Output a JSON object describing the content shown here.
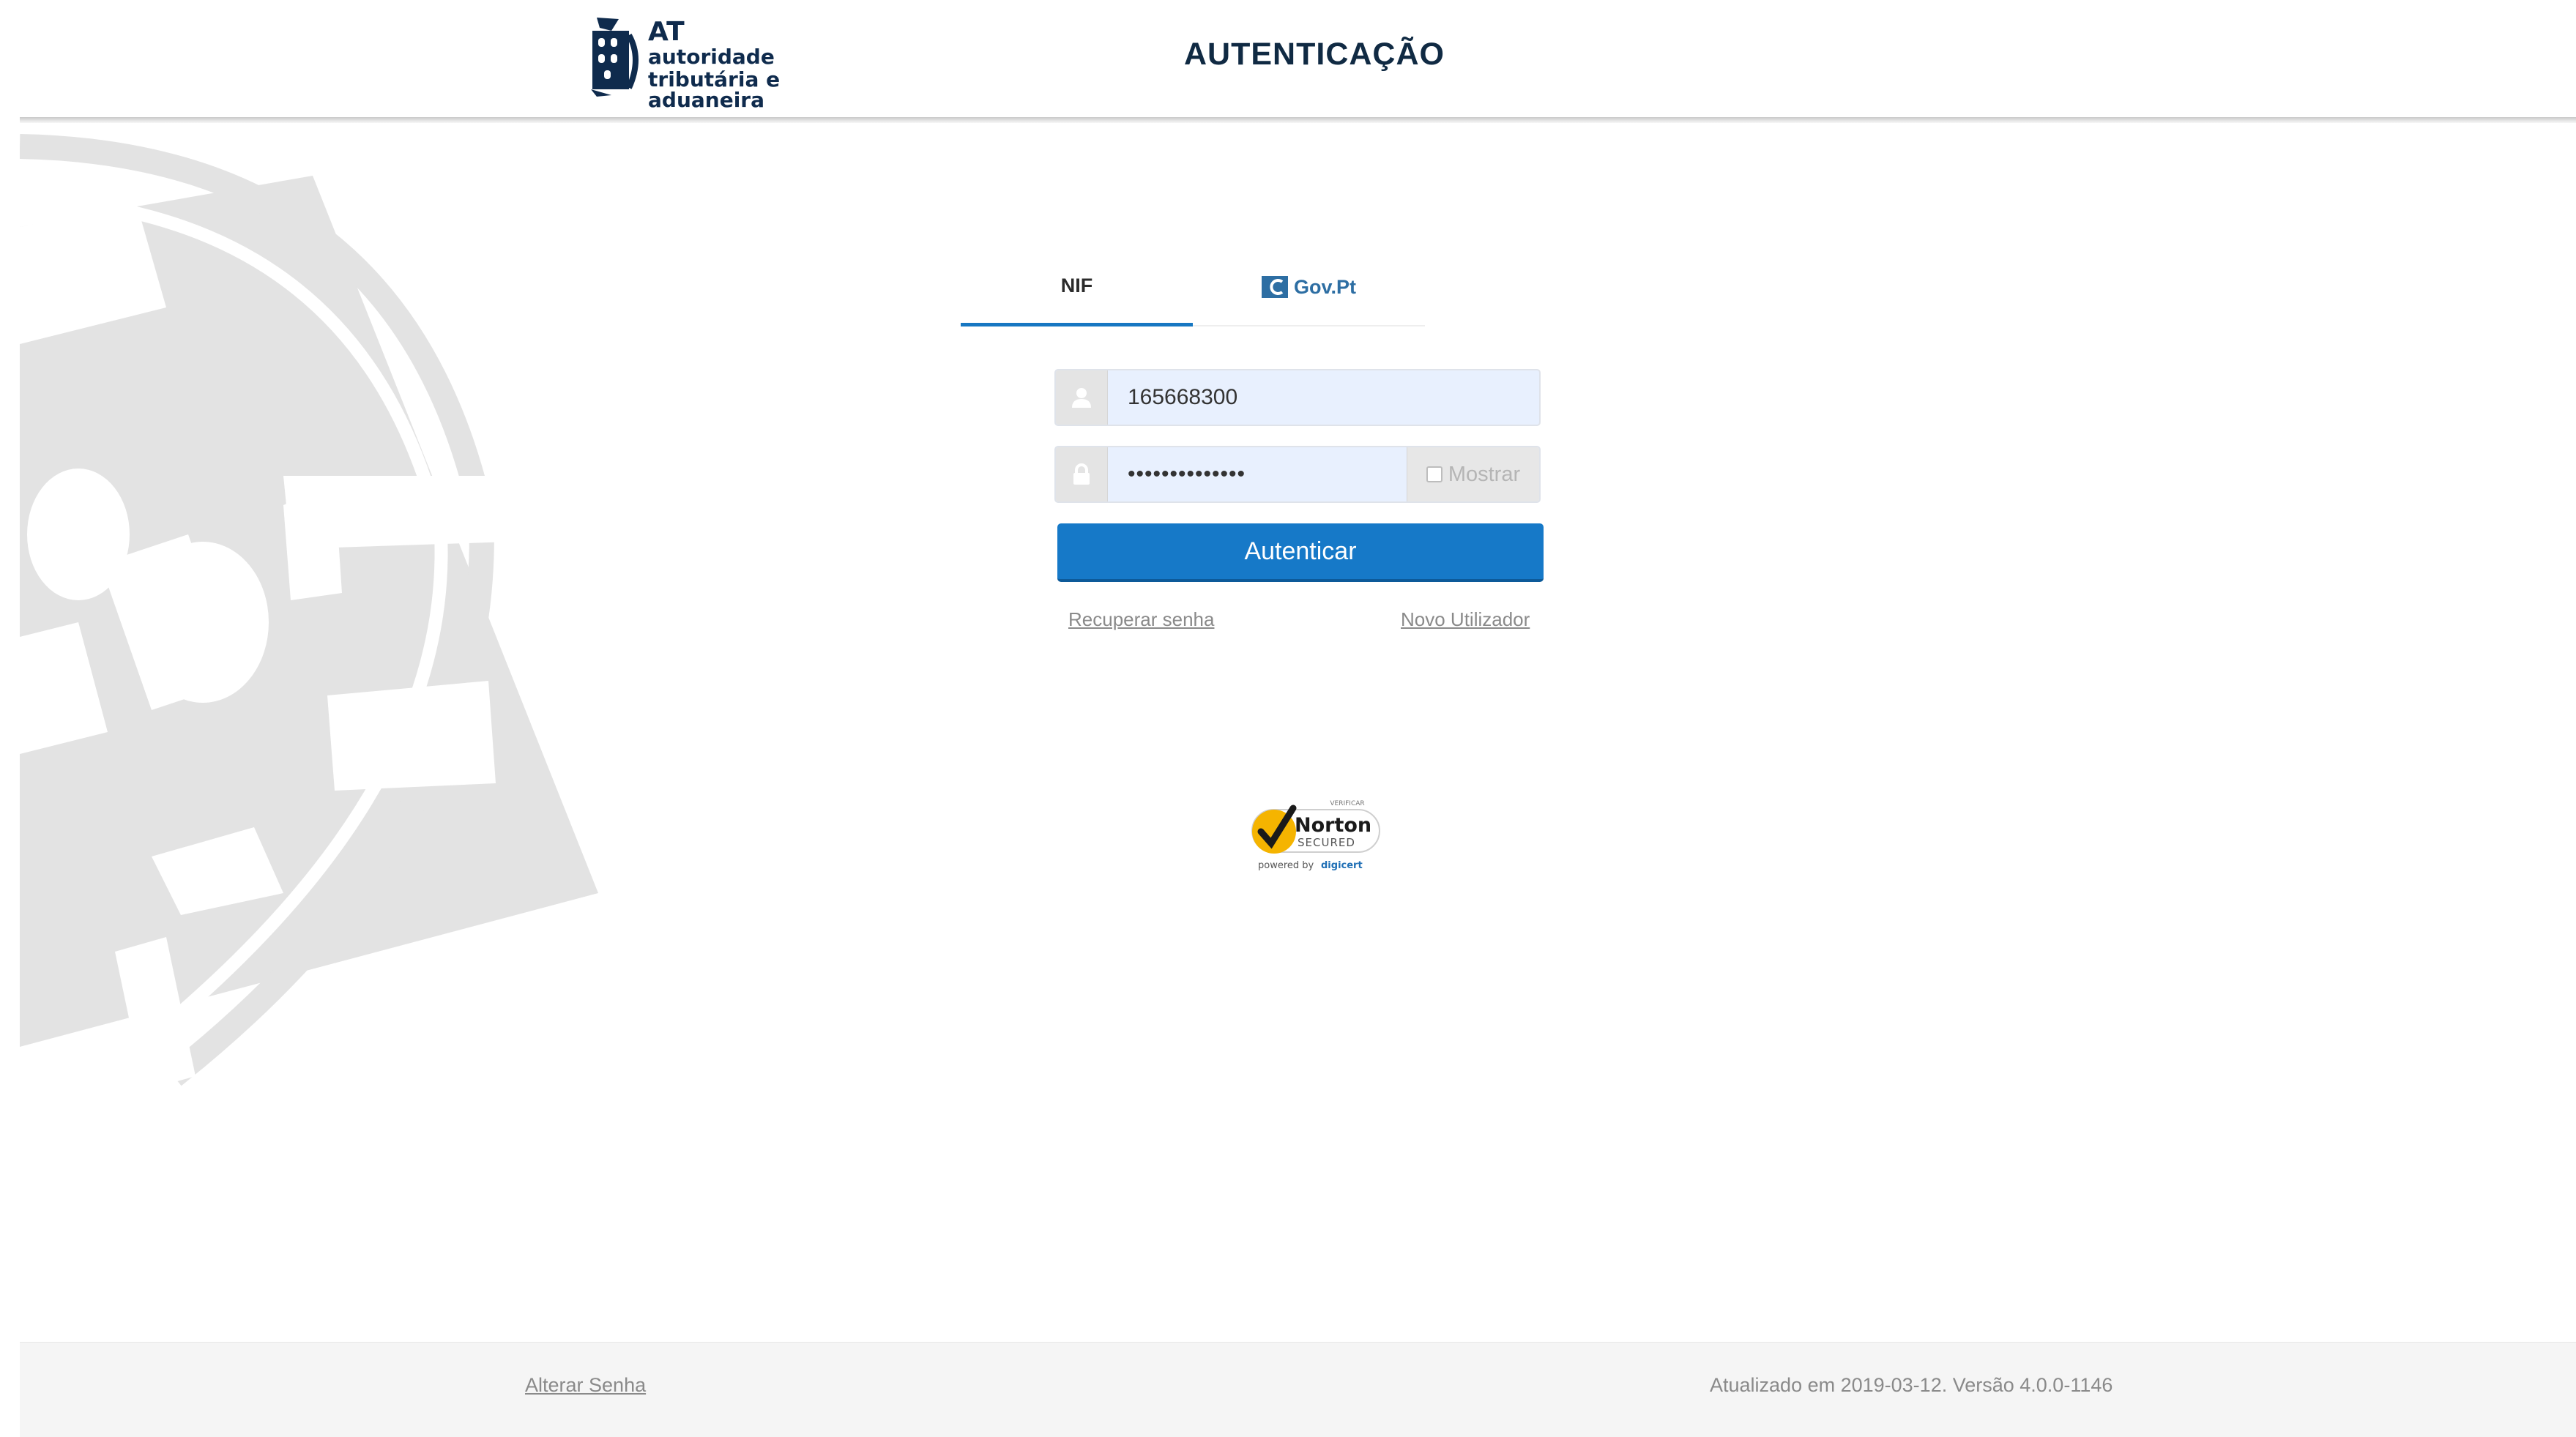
{
  "header": {
    "logo": {
      "abbr": "AT",
      "line1": "autoridade",
      "line2": "tributária e aduaneira"
    },
    "title": "AUTENTICAÇÃO"
  },
  "tabs": [
    {
      "label": "NIF",
      "active": true
    },
    {
      "label": "Gov.Pt",
      "active": false
    }
  ],
  "form": {
    "username_value": "165668300",
    "password_value": "••••••••••••••",
    "show_password_label": "Mostrar",
    "submit_label": "Autenticar",
    "recover_link": "Recuperar senha",
    "new_user_link": "Novo Utilizador"
  },
  "seal": {
    "top": "VERIFICAR",
    "brand": "Norton",
    "secured": "SECURED",
    "powered": "powered by",
    "provider": "digicert"
  },
  "footer": {
    "change_password_link": "Alterar Senha",
    "version_text": "Atualizado em 2019-03-12. Versão 4.0.0-1146"
  },
  "colors": {
    "accent": "#1679c8",
    "header_text": "#102a43",
    "input_background": "#e8f0fe",
    "watermark": "#e3e3e3"
  },
  "icons": [
    "logo-emblem-icon",
    "gov-pt-icon",
    "user-icon",
    "lock-icon",
    "checkbox-icon",
    "checkmark-icon"
  ]
}
